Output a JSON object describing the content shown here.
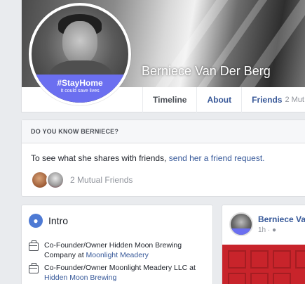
{
  "profile": {
    "name": "Berniece Van Der Berg",
    "frame_title": "#StayHome",
    "frame_subtitle": "It could save lives"
  },
  "tabs": [
    {
      "label": "Timeline",
      "active": true
    },
    {
      "label": "About"
    },
    {
      "label": "Friends",
      "count": "2 Mut"
    }
  ],
  "know": {
    "heading": "DO YOU KNOW BERNIECE?",
    "text": "To see what she shares with friends, ",
    "link": "send her a friend request.",
    "mutual": "2 Mutual Friends"
  },
  "intro": {
    "title": "Intro",
    "items": [
      {
        "text": "Co-Founder/Owner Hidden Moon Brewing Company at ",
        "link": "Moonlight Meadery"
      },
      {
        "text": "Co-Founder/Owner Moonlight Meadery LLC at ",
        "link": "Hidden Moon Brewing"
      }
    ]
  },
  "post": {
    "author": "Berniece Van",
    "time": "1h ·"
  },
  "colors": {
    "link": "#365899",
    "frame": "#6b6ff0",
    "post_image": "#c8242b"
  }
}
